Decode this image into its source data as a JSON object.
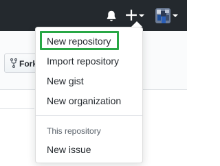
{
  "menu": {
    "items": [
      {
        "label": "New repository"
      },
      {
        "label": "Import repository"
      },
      {
        "label": "New gist"
      },
      {
        "label": "New organization"
      }
    ],
    "section_header": "This repository",
    "section_items": [
      {
        "label": "New issue"
      }
    ]
  },
  "page": {
    "fork_label": "Fork"
  },
  "header": {
    "icons": [
      "bell-icon",
      "plus-icon",
      "caret-down-icon",
      "avatar",
      "caret-down-icon"
    ]
  },
  "colors": {
    "header_bg": "#24292e",
    "highlight": "#28a745",
    "text": "#24292e",
    "muted": "#586069"
  }
}
